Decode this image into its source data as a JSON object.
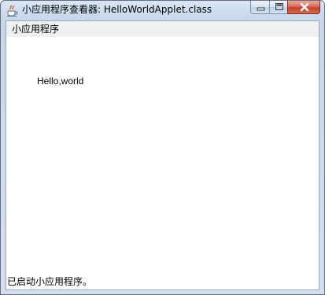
{
  "window": {
    "title": "小应用程序查看器: HelloWorldApplet.class",
    "app_icon": "java-icon"
  },
  "controls": {
    "minimize": "minimize-icon",
    "maximize": "maximize-icon",
    "close": "close-icon"
  },
  "menu": {
    "items": [
      {
        "label": "小应用程序"
      }
    ]
  },
  "applet": {
    "text": "Hello,world"
  },
  "status": {
    "text": "已启动小应用程序。"
  },
  "colors": {
    "titlebar": "#c7d8ec",
    "close_button": "#c4422c",
    "menubar": "#f0f0f0",
    "applet_background": "#ffffff"
  }
}
